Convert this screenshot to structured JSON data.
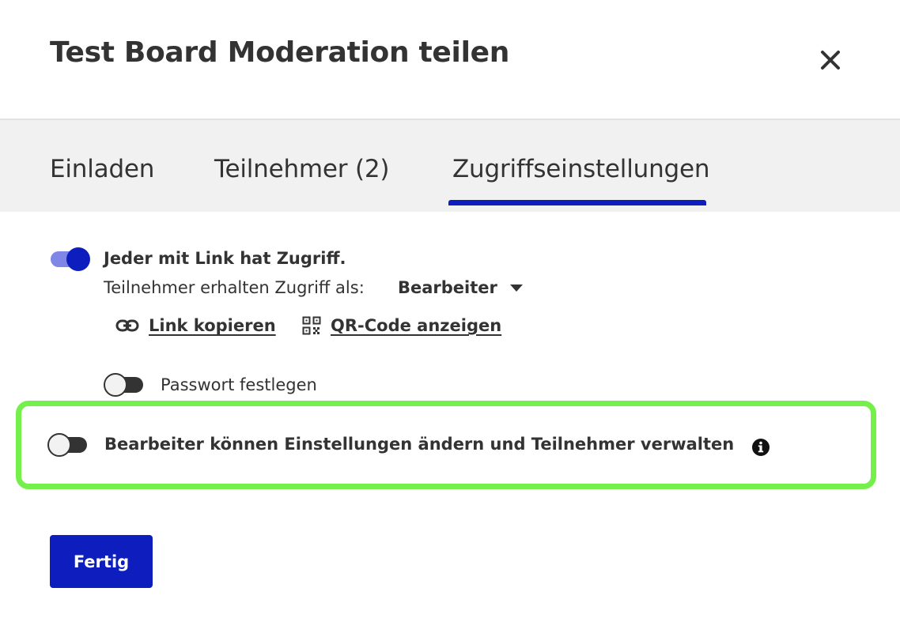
{
  "dialog": {
    "title": "Test Board Moderation teilen",
    "close_icon": "close-icon"
  },
  "tabs": [
    {
      "label": "Einladen",
      "active": false
    },
    {
      "label": "Teilnehmer (2)",
      "active": false
    },
    {
      "label": "Zugriffseinstellungen",
      "active": true
    }
  ],
  "access": {
    "link_toggle_on": true,
    "link_access_label": "Jeder mit Link hat Zugriff.",
    "role_label": "Teilnehmer erhalten Zugriff als:",
    "role_value": "Bearbeiter",
    "copy_link_label": "Link kopieren",
    "qr_label": "QR-Code anzeigen",
    "password_toggle_on": false,
    "password_label": "Passwort festlegen",
    "editor_toggle_on": false,
    "editor_label": "Bearbeiter können Einstellungen ändern und Teilnehmer verwalten"
  },
  "footer": {
    "done_label": "Fertig"
  },
  "colors": {
    "accent": "#0e1ebe",
    "toggle_on_track": "#7e86e6",
    "highlight": "#75f04a",
    "text": "#333333",
    "tabs_bg": "#f1f1f1"
  }
}
